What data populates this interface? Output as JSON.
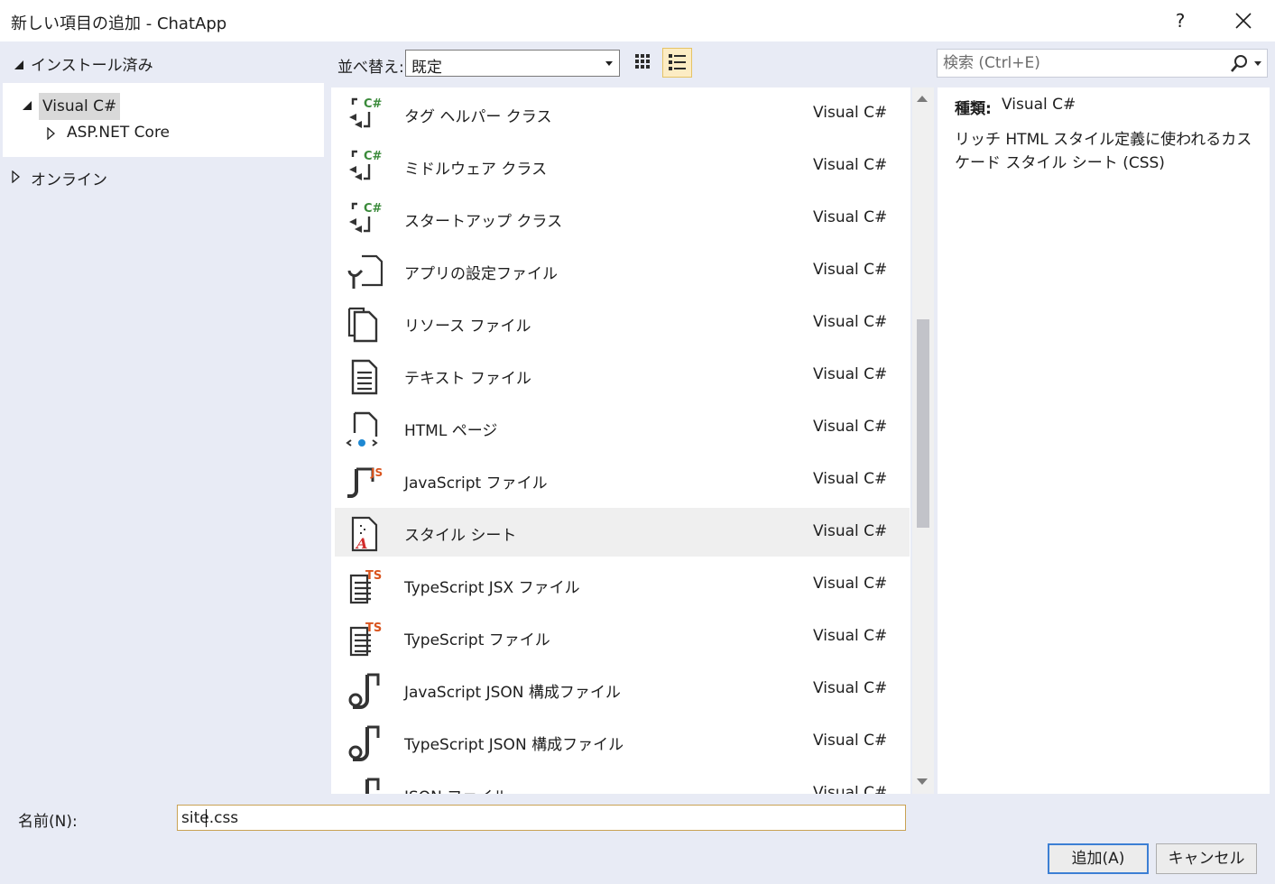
{
  "window": {
    "title": "新しい項目の追加 - ChatApp",
    "help_label": "?"
  },
  "tree": {
    "installed_label": "インストール済み",
    "visual_cs_label": "Visual C#",
    "aspnet_label": "ASP.NET Core",
    "online_label": "オンライン"
  },
  "sort": {
    "label": "並べ替え:",
    "value": "既定"
  },
  "search": {
    "placeholder": "検索 (Ctrl+E)"
  },
  "templates": [
    {
      "name": "タグ ヘルパー クラス",
      "lang": "Visual C#",
      "icon": "csharp-class-icon"
    },
    {
      "name": "ミドルウェア クラス",
      "lang": "Visual C#",
      "icon": "csharp-class-icon"
    },
    {
      "name": "スタートアップ クラス",
      "lang": "Visual C#",
      "icon": "csharp-class-icon"
    },
    {
      "name": "アプリの設定ファイル",
      "lang": "Visual C#",
      "icon": "settings-file-icon"
    },
    {
      "name": "リソース ファイル",
      "lang": "Visual C#",
      "icon": "resource-file-icon"
    },
    {
      "name": "テキスト ファイル",
      "lang": "Visual C#",
      "icon": "text-file-icon"
    },
    {
      "name": "HTML ページ",
      "lang": "Visual C#",
      "icon": "html-page-icon"
    },
    {
      "name": "JavaScript ファイル",
      "lang": "Visual C#",
      "icon": "javascript-file-icon"
    },
    {
      "name": "スタイル シート",
      "lang": "Visual C#",
      "icon": "stylesheet-icon",
      "selected": true
    },
    {
      "name": "TypeScript JSX ファイル",
      "lang": "Visual C#",
      "icon": "typescript-file-icon"
    },
    {
      "name": "TypeScript ファイル",
      "lang": "Visual C#",
      "icon": "typescript-file-icon"
    },
    {
      "name": "JavaScript JSON 構成ファイル",
      "lang": "Visual C#",
      "icon": "json-config-icon"
    },
    {
      "name": "TypeScript JSON 構成ファイル",
      "lang": "Visual C#",
      "icon": "json-config-icon"
    },
    {
      "name": "JSON ファイル",
      "lang": "Visual C#",
      "icon": "json-config-icon"
    }
  ],
  "details": {
    "kind_label": "種類:",
    "kind_value": "Visual C#",
    "description": "リッチ HTML スタイル定義に使われるカスケード スタイル シート (CSS)"
  },
  "name_field": {
    "label": "名前(N):",
    "value": "site.css"
  },
  "buttons": {
    "add_label": "追加(A)",
    "cancel_label": "キャンセル"
  },
  "colors": {
    "dialog_bg": "#e8ebf5",
    "selection_bg": "#efefef",
    "accent_blue": "#3c7fd4",
    "csharp_green": "#3a8a3a",
    "ts_orange": "#d9541e"
  }
}
